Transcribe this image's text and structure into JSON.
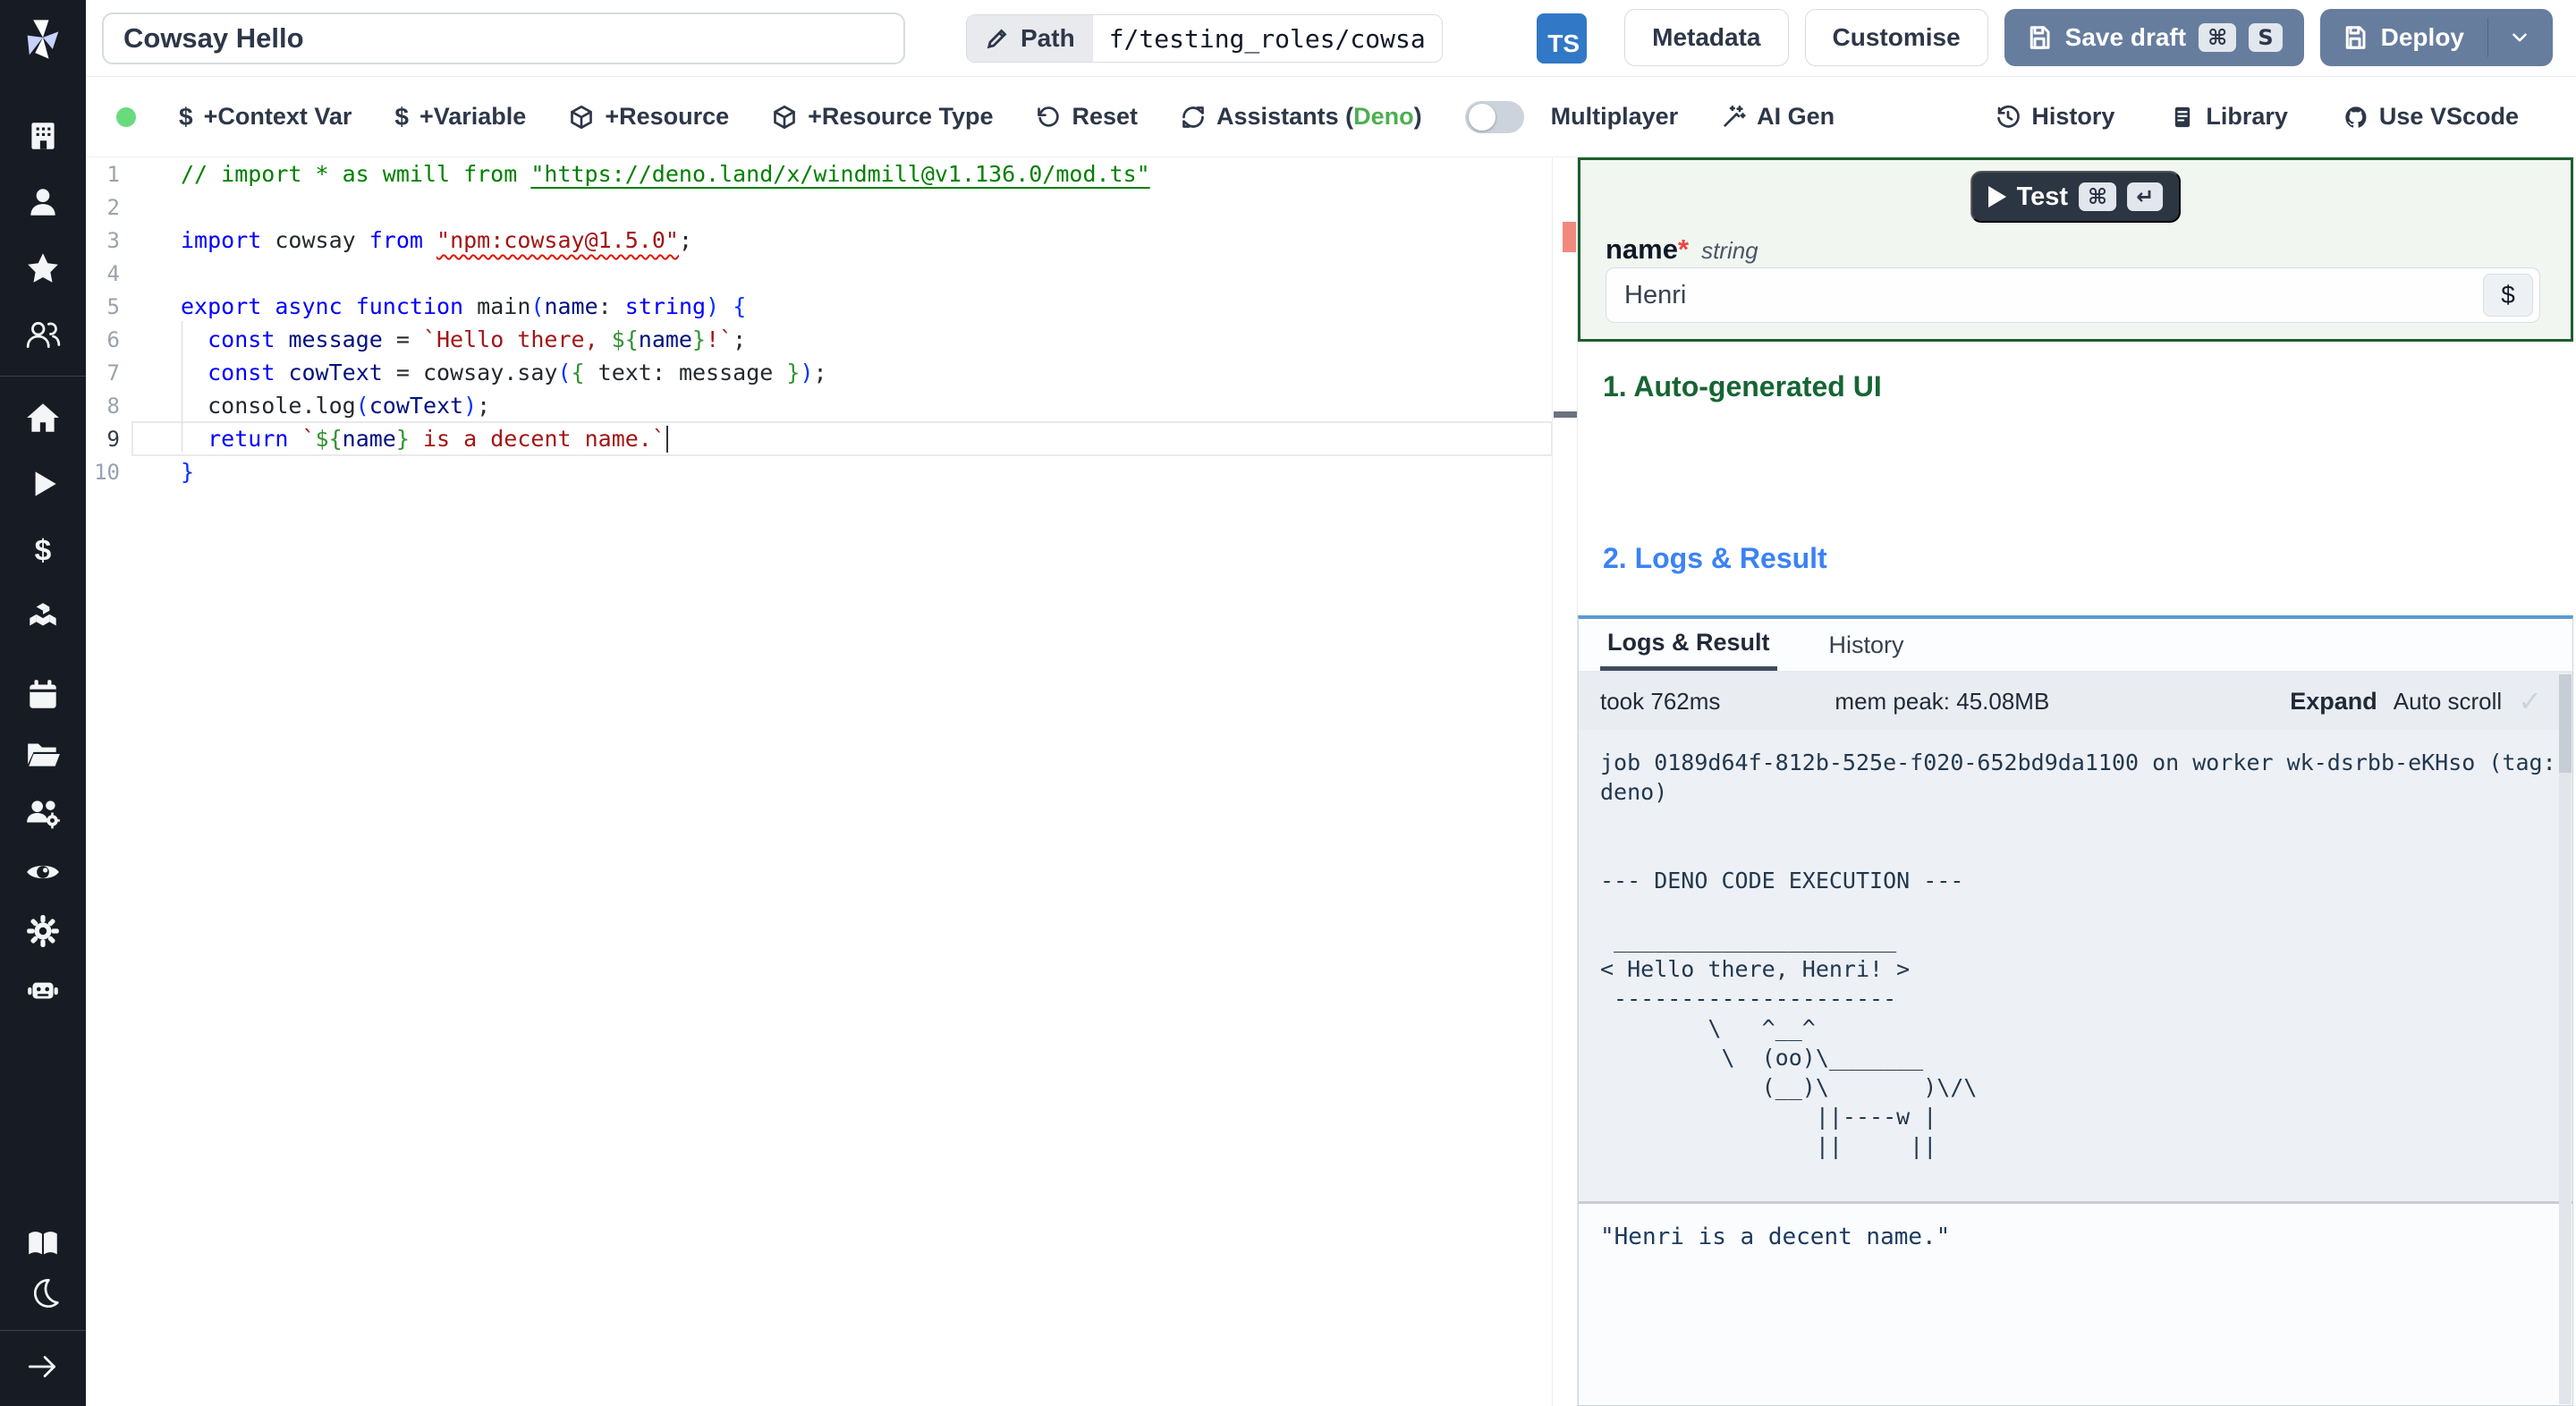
{
  "topbar": {
    "title": "Cowsay Hello",
    "path_label": "Path",
    "path_value": "f/testing_roles/cowsa",
    "lang_badge": "TS",
    "metadata": "Metadata",
    "customise": "Customise",
    "save_draft": "Save draft",
    "save_kbd_mod": "⌘",
    "save_kbd_key": "S",
    "deploy": "Deploy"
  },
  "toolbar": {
    "context_var": "+Context Var",
    "variable": "+Variable",
    "resource": "+Resource",
    "resource_type": "+Resource Type",
    "reset": "Reset",
    "assistants_pre": "Assistants (",
    "assistants_lang": "Deno",
    "assistants_post": ")",
    "multiplayer": "Multiplayer",
    "ai_gen": "AI Gen",
    "history": "History",
    "library": "Library",
    "use_vscode": "Use VScode",
    "dollar_glyph": "$"
  },
  "editor": {
    "active_line": 9,
    "lines": [
      {
        "n": "1",
        "tokens": [
          [
            "cm",
            "// import * as wmill from "
          ],
          [
            "cml",
            "\"https://deno.land/x/windmill@v1.136.0/mod.ts\""
          ]
        ]
      },
      {
        "n": "2",
        "tokens": []
      },
      {
        "n": "3",
        "tokens": [
          [
            "kw",
            "import"
          ],
          [
            "pl",
            " cowsay "
          ],
          [
            "kw",
            "from"
          ],
          [
            "pl",
            " "
          ],
          [
            "strE",
            "\"npm:cowsay@1.5.0\""
          ],
          [
            "pl",
            ";"
          ]
        ]
      },
      {
        "n": "4",
        "tokens": []
      },
      {
        "n": "5",
        "tokens": [
          [
            "kw",
            "export"
          ],
          [
            "pl",
            " "
          ],
          [
            "kw",
            "async"
          ],
          [
            "pl",
            " "
          ],
          [
            "kw",
            "function"
          ],
          [
            "pl",
            " main"
          ],
          [
            "br1",
            "("
          ],
          [
            "id",
            "name"
          ],
          [
            "pl",
            ": "
          ],
          [
            "kw",
            "string"
          ],
          [
            "br1",
            ")"
          ],
          [
            "pl",
            " "
          ],
          [
            "br1",
            "{"
          ]
        ]
      },
      {
        "n": "6",
        "tokens": [
          [
            "pl",
            "  "
          ],
          [
            "kw",
            "const"
          ],
          [
            "pl",
            " "
          ],
          [
            "id",
            "message"
          ],
          [
            "pl",
            " = "
          ],
          [
            "str",
            "`Hello there, "
          ],
          [
            "br2",
            "${"
          ],
          [
            "id",
            "name"
          ],
          [
            "br2",
            "}"
          ],
          [
            "str",
            "!`"
          ],
          [
            "pl",
            ";"
          ]
        ]
      },
      {
        "n": "7",
        "tokens": [
          [
            "pl",
            "  "
          ],
          [
            "kw",
            "const"
          ],
          [
            "pl",
            " "
          ],
          [
            "id",
            "cowText"
          ],
          [
            "pl",
            " = cowsay.say"
          ],
          [
            "br1",
            "("
          ],
          [
            "br2",
            "{"
          ],
          [
            "pl",
            " text: message "
          ],
          [
            "br2",
            "}"
          ],
          [
            "br1",
            ")"
          ],
          [
            "pl",
            ";"
          ]
        ]
      },
      {
        "n": "8",
        "tokens": [
          [
            "pl",
            "  console.log"
          ],
          [
            "br1",
            "("
          ],
          [
            "id",
            "cowText"
          ],
          [
            "br1",
            ")"
          ],
          [
            "pl",
            ";"
          ]
        ]
      },
      {
        "n": "9",
        "tokens": [
          [
            "pl",
            "  "
          ],
          [
            "kw",
            "return"
          ],
          [
            "pl",
            " "
          ],
          [
            "str",
            "`"
          ],
          [
            "br2",
            "${"
          ],
          [
            "id",
            "name"
          ],
          [
            "br2",
            "}"
          ],
          [
            "str",
            " is a decent name.`"
          ],
          [
            "cursor",
            ""
          ]
        ]
      },
      {
        "n": "10",
        "tokens": [
          [
            "br1",
            "}"
          ]
        ]
      }
    ]
  },
  "test_panel": {
    "test_button": "Test",
    "test_kbd_mod": "⌘",
    "test_kbd_enter": "↵",
    "field_name": "name",
    "required_mark": "*",
    "field_type": "string",
    "field_value": "Henri",
    "dollar_button": "$"
  },
  "sections": {
    "auto_ui_title": "1. Auto-generated UI",
    "logs_title": "2. Logs & Result"
  },
  "logs_panel": {
    "tab_logs": "Logs & Result",
    "tab_history": "History",
    "took": "took 762ms",
    "mem_peak": "mem peak: 45.08MB",
    "expand": "Expand",
    "auto_scroll": "Auto scroll",
    "check": "✓",
    "log_lines": [
      "job 0189d64f-812b-525e-f020-652bd9da1100 on worker wk-dsrbb-eKHso (tag:",
      "deno)",
      "",
      "",
      "--- DENO CODE EXECUTION ---",
      "",
      " _____________________",
      "< Hello there, Henri! >",
      " ---------------------",
      "        \\   ^__^",
      "         \\  (oo)\\_______",
      "            (__)\\       )\\/\\",
      "                ||----w |",
      "                ||     ||"
    ],
    "result": "\"Henri is a decent name.\""
  },
  "colors": {
    "primary_button": "#667d9e",
    "ts_badge": "#3178c6",
    "section_green": "#166534",
    "section_blue": "#3b82f6",
    "status_dot": "#69db7c",
    "deno_green": "#4caf50",
    "error_marker": "#f2897f",
    "sidebar_bg": "#171c24",
    "test_border": "#1d5e2f"
  }
}
